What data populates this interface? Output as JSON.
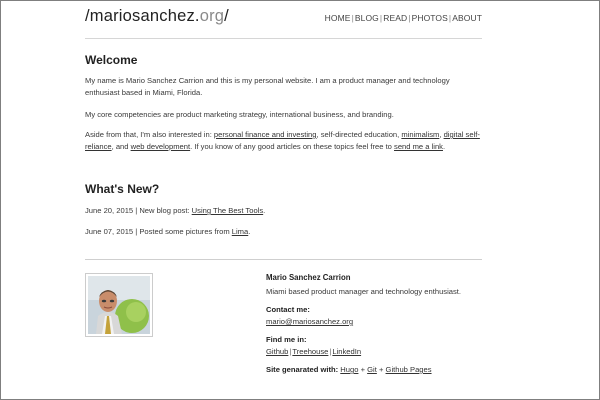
{
  "header": {
    "logo_prefix": "/mariosanchez.",
    "logo_tld": "org",
    "logo_suffix": "/",
    "nav": [
      "HOME",
      "BLOG",
      "READ",
      "PHOTOS",
      "ABOUT"
    ],
    "nav_separator": "|"
  },
  "welcome": {
    "title": "Welcome",
    "p1": "My name is Mario Sanchez Carrion and this is my personal website. I am a product manager and technology enthusiast based in Miami, Florida.",
    "p2": "My core competencies are product marketing strategy, international business, and branding.",
    "p3": {
      "t1": "Aside from that, I'm also interested in: ",
      "l1": "personal finance and investing",
      "t2": ", self-directed education, ",
      "l2": "minimalism",
      "t3": ", ",
      "l3": "digital self-reliance",
      "t4": ", and ",
      "l4": "web development",
      "t5": ". If you know of any good articles on these topics feel free to ",
      "l5": "send me a link",
      "t6": "."
    }
  },
  "news": {
    "title": "What's New?",
    "items": [
      {
        "text": "June 20, 2015 | New blog post: ",
        "link": "Using The Best Tools",
        "end": "."
      },
      {
        "text": "June 07, 2015 | Posted some pictures from ",
        "link": "Lima",
        "end": "."
      }
    ]
  },
  "bio": {
    "name": "Mario Sanchez Carrion",
    "tagline": "Miami based product manager and technology enthusiast.",
    "contact_label": "Contact me:",
    "email": "mario@mariosanchez.org",
    "find_label": "Find me in:",
    "links": [
      "Github",
      "Treehouse",
      "LinkedIn"
    ],
    "link_separator": "|",
    "generated_label": "Site genarated with:",
    "generated_links": [
      "Hugo",
      "Git",
      "Github Pages"
    ],
    "generated_separator": "+"
  },
  "colors": {
    "text": "#333333",
    "heading": "#222222",
    "divider": "#cfcfcf",
    "photo_green": "#8fc04a"
  }
}
